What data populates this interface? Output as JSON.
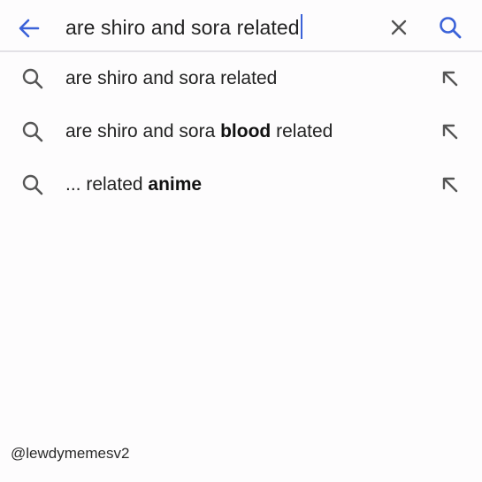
{
  "search": {
    "query": "are shiro and sora related"
  },
  "icons": {
    "back": "arrow-left-icon",
    "clear": "close-icon",
    "search": "search-icon",
    "suggestion": "search-icon",
    "fill": "arrow-up-left-icon"
  },
  "colors": {
    "accent": "#3b62d8",
    "icon_gray": "#555555",
    "text": "#222222",
    "divider": "#e3e1e6",
    "background": "#fdfcfd"
  },
  "suggestions": [
    {
      "prefix": "are shiro and sora related",
      "bold": "",
      "suffix": ""
    },
    {
      "prefix": "are shiro and sora ",
      "bold": "blood",
      "suffix": " related"
    },
    {
      "prefix": "... related ",
      "bold": "anime",
      "suffix": ""
    }
  ],
  "watermark": "@lewdymemesv2"
}
